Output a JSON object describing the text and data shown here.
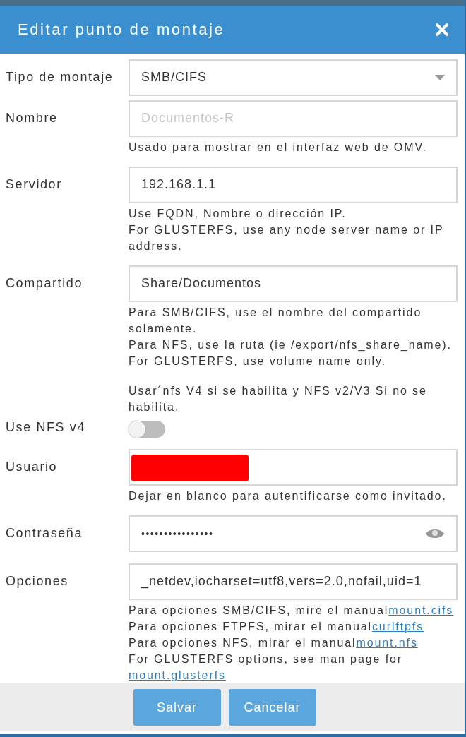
{
  "dialog": {
    "title": "Editar punto de montaje"
  },
  "fields": [
    {
      "kind": "select",
      "label": "Tipo de montaje",
      "value": "SMB/CIFS"
    },
    {
      "kind": "text",
      "label": "Nombre",
      "placeholder": "Documentos-R",
      "help": [
        {
          "text": "Usado para mostrar en el interfaz web de OMV."
        }
      ]
    },
    {
      "kind": "text",
      "label": "Servidor",
      "value": "192.168.1.1",
      "help": [
        {
          "text": "Use FQDN, Nombre o dirección IP."
        },
        {
          "text": "For GLUSTERFS, use any node server name or IP address."
        }
      ]
    },
    {
      "kind": "text",
      "label": "Compartido",
      "value": "Share/Documentos",
      "help": [
        {
          "text": "Para SMB/CIFS, use el nombre del compartido solamente."
        },
        {
          "text": "Para NFS, use la ruta (ie /export/nfs_share_name)."
        },
        {
          "text": "For GLUSTERFS, use volume name only."
        }
      ]
    },
    {
      "kind": "toggle",
      "label": "Use NFS v4",
      "on": false,
      "help": [
        {
          "text": "Usar´nfs V4 si se habilita y NFS v2/V3 Si no se habilita."
        }
      ]
    },
    {
      "kind": "text",
      "label": "Usuario",
      "redacted": true,
      "help": [
        {
          "text": "Dejar en blanco para autentificarse como invitado."
        }
      ]
    },
    {
      "kind": "password",
      "label": "Contraseña",
      "value": "••••••••••••••••"
    },
    {
      "kind": "text",
      "label": "Opciones",
      "value": "_netdev,iocharset=utf8,vers=2.0,nofail,uid=1",
      "help": [
        {
          "text": "Para opciones SMB/CIFS, mire el manual",
          "link": "mount.cifs"
        },
        {
          "text": "Para opciones FTPFS, mirar el manual",
          "link": "curlftpfs"
        },
        {
          "text": "Para opciones NFS, mirar el manual",
          "link": "mount.nfs"
        },
        {
          "text": "For GLUSTERFS options, see man page for"
        },
        {
          "link": "mount.glusterfs"
        }
      ]
    }
  ],
  "buttons": [
    "Salvar",
    "Cancelar"
  ]
}
